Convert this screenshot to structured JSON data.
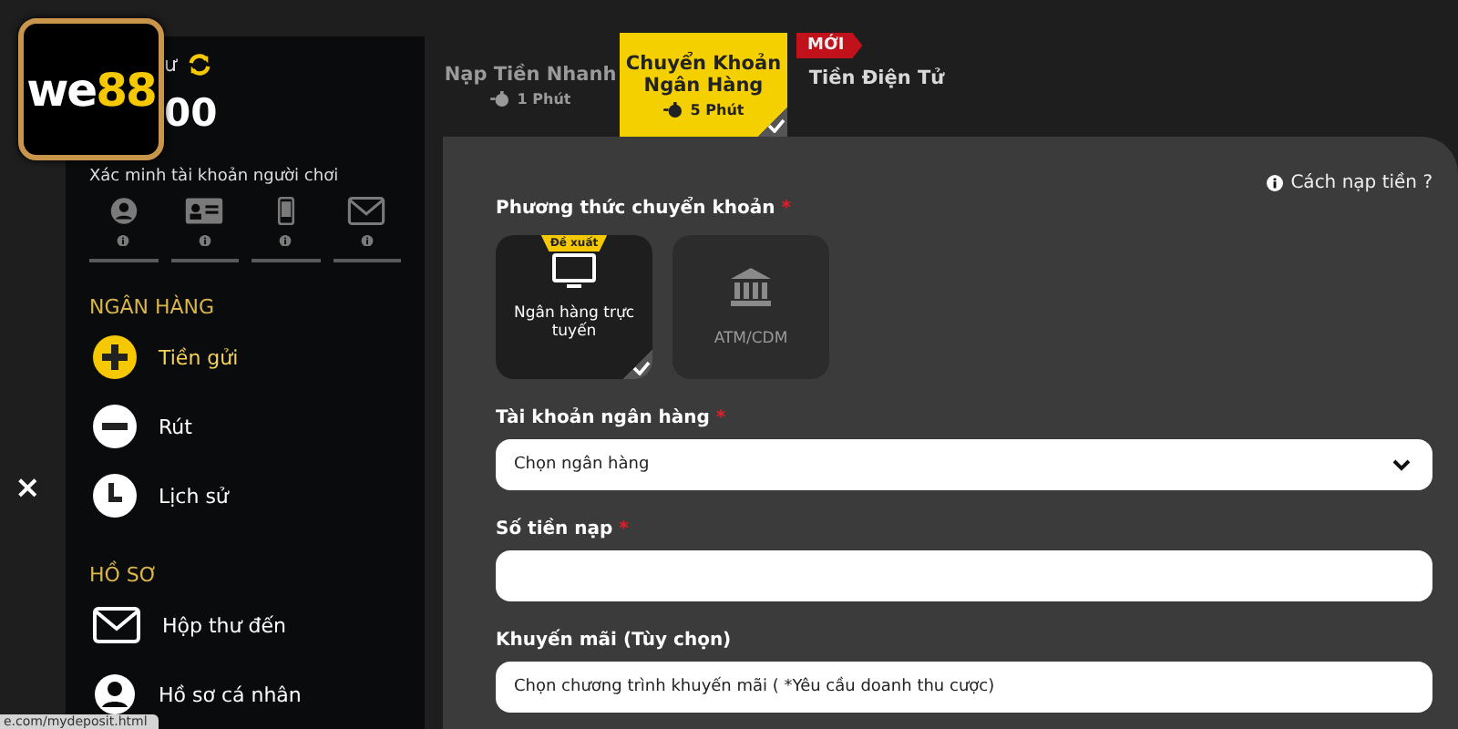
{
  "logo": {
    "word": "we",
    "number": "88"
  },
  "close_button": "×",
  "status_url": "e.com/mydeposit.html",
  "sidebar": {
    "balance_label": "ư",
    "balance": "00",
    "verify_title": "Xác minh tài khoản người chơi",
    "verify_items": [
      {
        "kind": "user",
        "verified": false
      },
      {
        "kind": "idcard",
        "verified": false
      },
      {
        "kind": "phone",
        "verified": false
      },
      {
        "kind": "mail",
        "verified": false
      }
    ],
    "sections": [
      {
        "title": "NGÂN HÀNG",
        "items": [
          {
            "kind": "plus",
            "label": "Tiền gửi",
            "selected": true
          },
          {
            "kind": "minus",
            "label": "Rút",
            "selected": false
          },
          {
            "kind": "clock",
            "label": "Lịch sử",
            "selected": false
          }
        ]
      },
      {
        "title": "HỒ SƠ",
        "items": [
          {
            "kind": "mail",
            "label": "Hộp thư đến",
            "selected": false
          },
          {
            "kind": "user",
            "label": "Hồ sơ cá nhân",
            "selected": false
          }
        ]
      }
    ]
  },
  "tabs": [
    {
      "title": "Nạp Tiền Nhanh",
      "time": "1 Phút",
      "selected": false
    },
    {
      "title": "Chuyển Khoản Ngân Hàng",
      "time": "5 Phút",
      "selected": true
    },
    {
      "title": "Tiền Điện Tử",
      "badge": "MỚI",
      "selected": false
    }
  ],
  "help_link": "Cách nạp tiền ?",
  "method": {
    "label": "Phương thức chuyển khoản",
    "mark": "*",
    "options": [
      {
        "kind": "monitor",
        "label": "Ngân hàng trực tuyến",
        "badge": "Đề xuất",
        "selected": true
      },
      {
        "kind": "bank",
        "label": "ATM/CDM",
        "selected": false
      }
    ]
  },
  "bank_account": {
    "label": "Tài khoản ngân hàng",
    "mark": "*",
    "value": "Chọn ngân hàng"
  },
  "amount": {
    "label": "Số tiền nạp",
    "mark": "*"
  },
  "promo": {
    "label": "Khuyến mãi (Tùy chọn)",
    "value": "Chọn chương trình khuyến mãi ( *Yêu cầu doanh thu cược)"
  }
}
